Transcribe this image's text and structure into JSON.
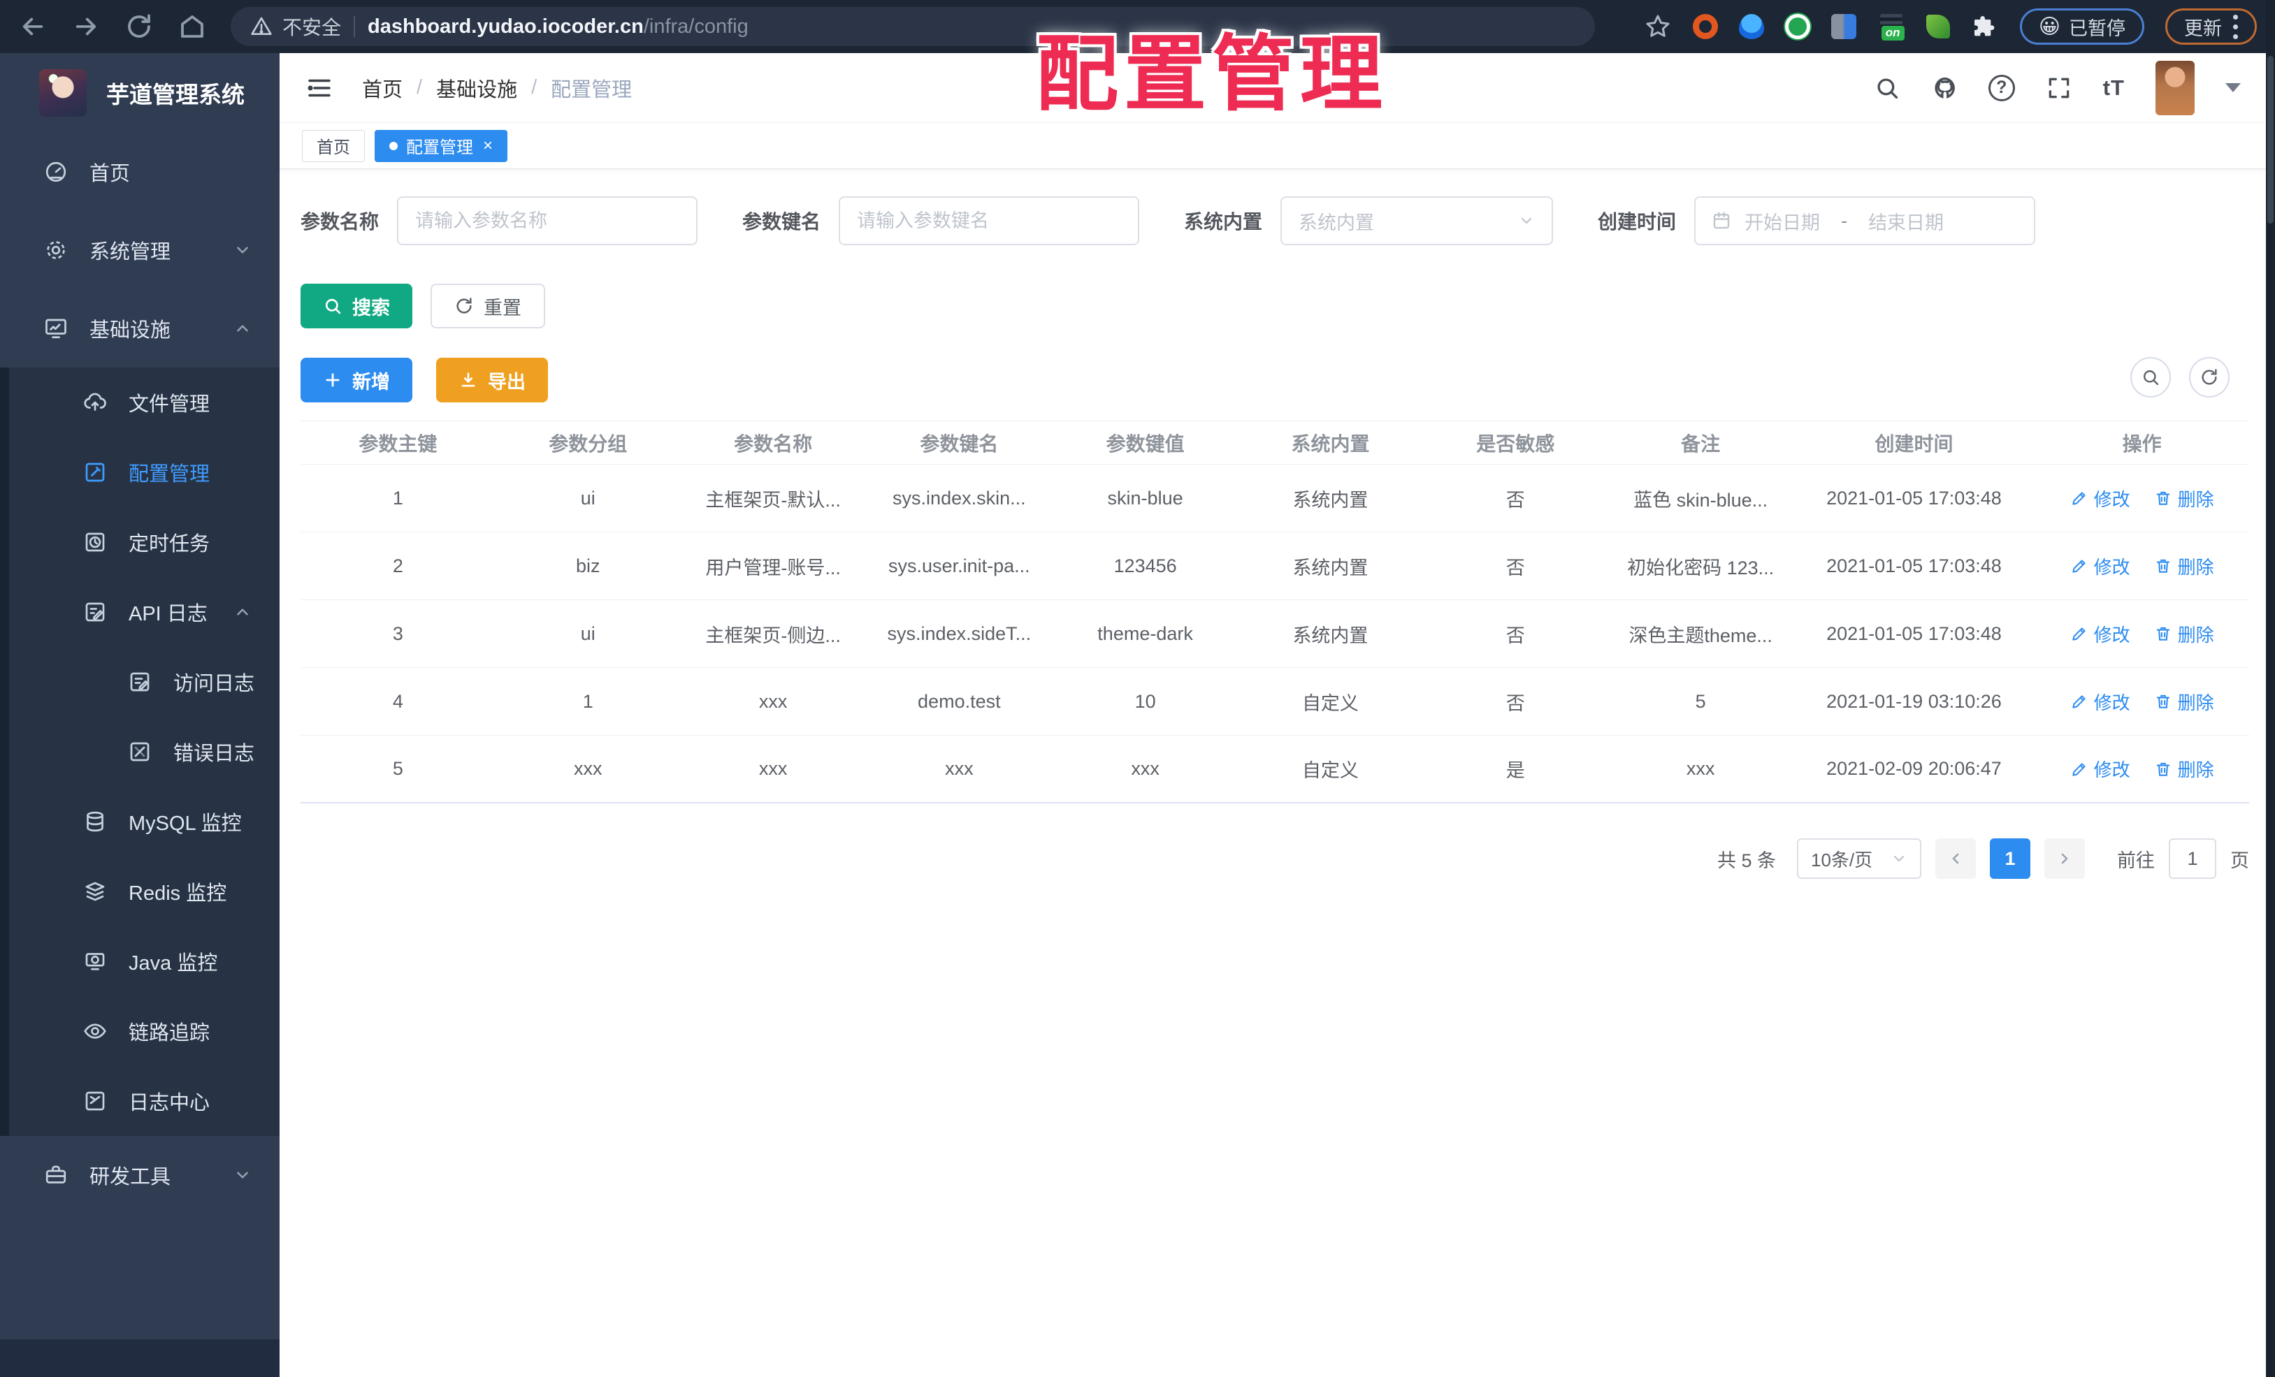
{
  "browser": {
    "security_label": "不安全",
    "url_host": "dashboard.yudao.iocoder.cn",
    "url_path": "/infra/config",
    "extension_badge": "on",
    "paused_emoji": "😀",
    "paused_button": "已暂停",
    "update_button": "更新"
  },
  "overlay": {
    "title": "配置管理"
  },
  "sidebar": {
    "app_title": "芋道管理系统",
    "items": [
      {
        "label": "首页",
        "icon": "dashboard-icon"
      },
      {
        "label": "系统管理",
        "icon": "gear-icon",
        "expand": "down"
      },
      {
        "label": "基础设施",
        "icon": "infra-icon",
        "expand": "up"
      },
      {
        "label": "文件管理",
        "icon": "cloud-upload-icon"
      },
      {
        "label": "配置管理",
        "icon": "config-edit-icon",
        "active": true
      },
      {
        "label": "定时任务",
        "icon": "timer-icon"
      },
      {
        "label": "API 日志",
        "icon": "api-log-icon",
        "expand": "up"
      },
      {
        "label": "访问日志",
        "icon": "access-log-icon"
      },
      {
        "label": "错误日志",
        "icon": "error-log-icon"
      },
      {
        "label": "MySQL 监控",
        "icon": "mysql-icon"
      },
      {
        "label": "Redis 监控",
        "icon": "redis-icon"
      },
      {
        "label": "Java 监控",
        "icon": "java-icon"
      },
      {
        "label": "链路追踪",
        "icon": "trace-eye-icon"
      },
      {
        "label": "日志中心",
        "icon": "log-center-icon"
      },
      {
        "label": "研发工具",
        "icon": "devtools-icon",
        "expand": "down"
      }
    ]
  },
  "header": {
    "breadcrumb": {
      "0": "首页",
      "1": "基础设施",
      "2": "配置管理",
      "separator": "/"
    }
  },
  "tags": {
    "0": {
      "label": "首页"
    },
    "1": {
      "label": "配置管理"
    }
  },
  "filters": {
    "name_label": "参数名称",
    "name_placeholder": "请输入参数名称",
    "key_label": "参数键名",
    "key_placeholder": "请输入参数键名",
    "type_label": "系统内置",
    "type_placeholder": "系统内置",
    "date_label": "创建时间",
    "date_start_placeholder": "开始日期",
    "date_separator": "-",
    "date_end_placeholder": "结束日期"
  },
  "toolbar": {
    "search_label": "搜索",
    "reset_label": "重置",
    "add_label": "新增",
    "export_label": "导出"
  },
  "table": {
    "columns": [
      "参数主键",
      "参数分组",
      "参数名称",
      "参数键名",
      "参数键值",
      "系统内置",
      "是否敏感",
      "备注",
      "创建时间",
      "操作"
    ],
    "edit_label": "修改",
    "delete_label": "删除",
    "rows": [
      {
        "id": "1",
        "group": "ui",
        "name": "主框架页-默认...",
        "key": "sys.index.skin...",
        "value": "skin-blue",
        "type": "系统内置",
        "sensitive": "否",
        "remark": "蓝色 skin-blue...",
        "created": "2021-01-05 17:03:48"
      },
      {
        "id": "2",
        "group": "biz",
        "name": "用户管理-账号...",
        "key": "sys.user.init-pa...",
        "value": "123456",
        "type": "系统内置",
        "sensitive": "否",
        "remark": "初始化密码 123...",
        "created": "2021-01-05 17:03:48"
      },
      {
        "id": "3",
        "group": "ui",
        "name": "主框架页-侧边...",
        "key": "sys.index.sideT...",
        "value": "theme-dark",
        "type": "系统内置",
        "sensitive": "否",
        "remark": "深色主题theme...",
        "created": "2021-01-05 17:03:48"
      },
      {
        "id": "4",
        "group": "1",
        "name": "xxx",
        "key": "demo.test",
        "value": "10",
        "type": "自定义",
        "sensitive": "否",
        "remark": "5",
        "created": "2021-01-19 03:10:26"
      },
      {
        "id": "5",
        "group": "xxx",
        "name": "xxx",
        "key": "xxx",
        "value": "xxx",
        "type": "自定义",
        "sensitive": "是",
        "remark": "xxx",
        "created": "2021-02-09 20:06:47"
      }
    ]
  },
  "pagination": {
    "total": "共 5 条",
    "page_size": "10条/页",
    "current_page": "1",
    "goto_label": "前往",
    "goto_value": "1",
    "page_unit": "页"
  },
  "colors": {
    "accent_blue": "#2d8cf0",
    "teal": "#11a983",
    "orange": "#f0a020",
    "menu_active": "#3f9bff",
    "overlay_red": "#ee2b52"
  }
}
